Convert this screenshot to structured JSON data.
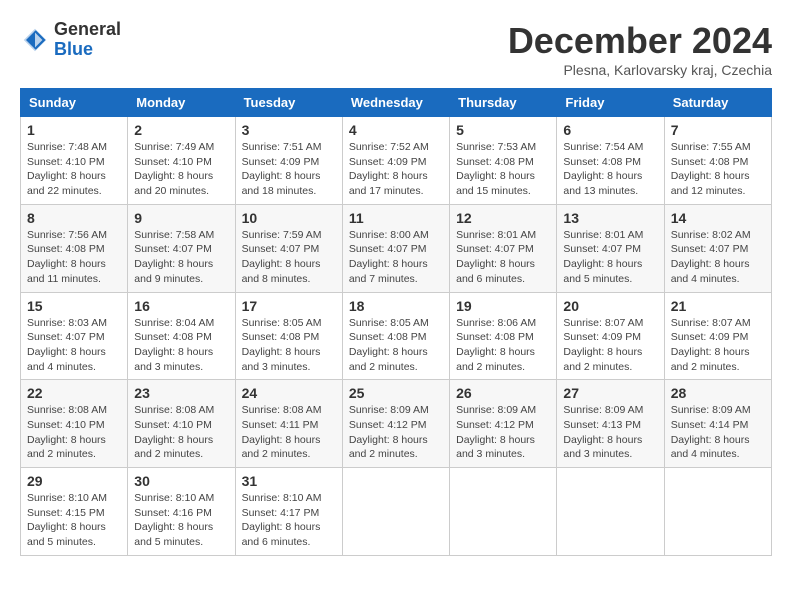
{
  "logo": {
    "general": "General",
    "blue": "Blue"
  },
  "title": "December 2024",
  "subtitle": "Plesna, Karlovarsky kraj, Czechia",
  "days_of_week": [
    "Sunday",
    "Monday",
    "Tuesday",
    "Wednesday",
    "Thursday",
    "Friday",
    "Saturday"
  ],
  "weeks": [
    [
      {
        "day": "1",
        "info": "Sunrise: 7:48 AM\nSunset: 4:10 PM\nDaylight: 8 hours\nand 22 minutes."
      },
      {
        "day": "2",
        "info": "Sunrise: 7:49 AM\nSunset: 4:10 PM\nDaylight: 8 hours\nand 20 minutes."
      },
      {
        "day": "3",
        "info": "Sunrise: 7:51 AM\nSunset: 4:09 PM\nDaylight: 8 hours\nand 18 minutes."
      },
      {
        "day": "4",
        "info": "Sunrise: 7:52 AM\nSunset: 4:09 PM\nDaylight: 8 hours\nand 17 minutes."
      },
      {
        "day": "5",
        "info": "Sunrise: 7:53 AM\nSunset: 4:08 PM\nDaylight: 8 hours\nand 15 minutes."
      },
      {
        "day": "6",
        "info": "Sunrise: 7:54 AM\nSunset: 4:08 PM\nDaylight: 8 hours\nand 13 minutes."
      },
      {
        "day": "7",
        "info": "Sunrise: 7:55 AM\nSunset: 4:08 PM\nDaylight: 8 hours\nand 12 minutes."
      }
    ],
    [
      {
        "day": "8",
        "info": "Sunrise: 7:56 AM\nSunset: 4:08 PM\nDaylight: 8 hours\nand 11 minutes."
      },
      {
        "day": "9",
        "info": "Sunrise: 7:58 AM\nSunset: 4:07 PM\nDaylight: 8 hours\nand 9 minutes."
      },
      {
        "day": "10",
        "info": "Sunrise: 7:59 AM\nSunset: 4:07 PM\nDaylight: 8 hours\nand 8 minutes."
      },
      {
        "day": "11",
        "info": "Sunrise: 8:00 AM\nSunset: 4:07 PM\nDaylight: 8 hours\nand 7 minutes."
      },
      {
        "day": "12",
        "info": "Sunrise: 8:01 AM\nSunset: 4:07 PM\nDaylight: 8 hours\nand 6 minutes."
      },
      {
        "day": "13",
        "info": "Sunrise: 8:01 AM\nSunset: 4:07 PM\nDaylight: 8 hours\nand 5 minutes."
      },
      {
        "day": "14",
        "info": "Sunrise: 8:02 AM\nSunset: 4:07 PM\nDaylight: 8 hours\nand 4 minutes."
      }
    ],
    [
      {
        "day": "15",
        "info": "Sunrise: 8:03 AM\nSunset: 4:07 PM\nDaylight: 8 hours\nand 4 minutes."
      },
      {
        "day": "16",
        "info": "Sunrise: 8:04 AM\nSunset: 4:08 PM\nDaylight: 8 hours\nand 3 minutes."
      },
      {
        "day": "17",
        "info": "Sunrise: 8:05 AM\nSunset: 4:08 PM\nDaylight: 8 hours\nand 3 minutes."
      },
      {
        "day": "18",
        "info": "Sunrise: 8:05 AM\nSunset: 4:08 PM\nDaylight: 8 hours\nand 2 minutes."
      },
      {
        "day": "19",
        "info": "Sunrise: 8:06 AM\nSunset: 4:08 PM\nDaylight: 8 hours\nand 2 minutes."
      },
      {
        "day": "20",
        "info": "Sunrise: 8:07 AM\nSunset: 4:09 PM\nDaylight: 8 hours\nand 2 minutes."
      },
      {
        "day": "21",
        "info": "Sunrise: 8:07 AM\nSunset: 4:09 PM\nDaylight: 8 hours\nand 2 minutes."
      }
    ],
    [
      {
        "day": "22",
        "info": "Sunrise: 8:08 AM\nSunset: 4:10 PM\nDaylight: 8 hours\nand 2 minutes."
      },
      {
        "day": "23",
        "info": "Sunrise: 8:08 AM\nSunset: 4:10 PM\nDaylight: 8 hours\nand 2 minutes."
      },
      {
        "day": "24",
        "info": "Sunrise: 8:08 AM\nSunset: 4:11 PM\nDaylight: 8 hours\nand 2 minutes."
      },
      {
        "day": "25",
        "info": "Sunrise: 8:09 AM\nSunset: 4:12 PM\nDaylight: 8 hours\nand 2 minutes."
      },
      {
        "day": "26",
        "info": "Sunrise: 8:09 AM\nSunset: 4:12 PM\nDaylight: 8 hours\nand 3 minutes."
      },
      {
        "day": "27",
        "info": "Sunrise: 8:09 AM\nSunset: 4:13 PM\nDaylight: 8 hours\nand 3 minutes."
      },
      {
        "day": "28",
        "info": "Sunrise: 8:09 AM\nSunset: 4:14 PM\nDaylight: 8 hours\nand 4 minutes."
      }
    ],
    [
      {
        "day": "29",
        "info": "Sunrise: 8:10 AM\nSunset: 4:15 PM\nDaylight: 8 hours\nand 5 minutes."
      },
      {
        "day": "30",
        "info": "Sunrise: 8:10 AM\nSunset: 4:16 PM\nDaylight: 8 hours\nand 5 minutes."
      },
      {
        "day": "31",
        "info": "Sunrise: 8:10 AM\nSunset: 4:17 PM\nDaylight: 8 hours\nand 6 minutes."
      },
      null,
      null,
      null,
      null
    ]
  ]
}
